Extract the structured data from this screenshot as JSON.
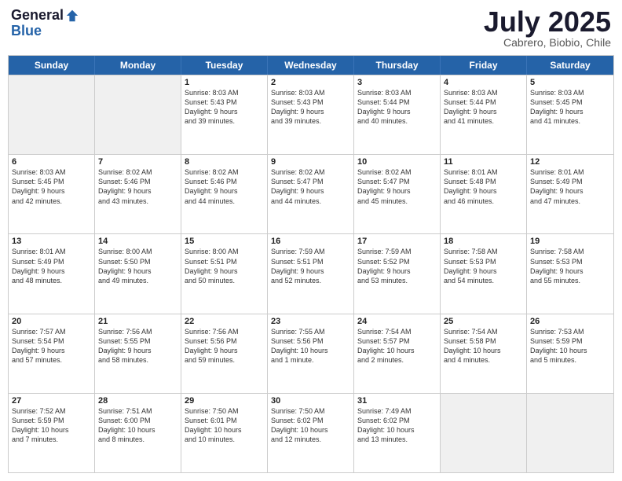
{
  "logo": {
    "general": "General",
    "blue": "Blue"
  },
  "title": "July 2025",
  "subtitle": "Cabrero, Biobio, Chile",
  "weekdays": [
    "Sunday",
    "Monday",
    "Tuesday",
    "Wednesday",
    "Thursday",
    "Friday",
    "Saturday"
  ],
  "weeks": [
    [
      {
        "day": "",
        "text": "",
        "shaded": true
      },
      {
        "day": "",
        "text": "",
        "shaded": true
      },
      {
        "day": "1",
        "text": "Sunrise: 8:03 AM\nSunset: 5:43 PM\nDaylight: 9 hours\nand 39 minutes."
      },
      {
        "day": "2",
        "text": "Sunrise: 8:03 AM\nSunset: 5:43 PM\nDaylight: 9 hours\nand 39 minutes."
      },
      {
        "day": "3",
        "text": "Sunrise: 8:03 AM\nSunset: 5:44 PM\nDaylight: 9 hours\nand 40 minutes."
      },
      {
        "day": "4",
        "text": "Sunrise: 8:03 AM\nSunset: 5:44 PM\nDaylight: 9 hours\nand 41 minutes."
      },
      {
        "day": "5",
        "text": "Sunrise: 8:03 AM\nSunset: 5:45 PM\nDaylight: 9 hours\nand 41 minutes."
      }
    ],
    [
      {
        "day": "6",
        "text": "Sunrise: 8:03 AM\nSunset: 5:45 PM\nDaylight: 9 hours\nand 42 minutes."
      },
      {
        "day": "7",
        "text": "Sunrise: 8:02 AM\nSunset: 5:46 PM\nDaylight: 9 hours\nand 43 minutes."
      },
      {
        "day": "8",
        "text": "Sunrise: 8:02 AM\nSunset: 5:46 PM\nDaylight: 9 hours\nand 44 minutes."
      },
      {
        "day": "9",
        "text": "Sunrise: 8:02 AM\nSunset: 5:47 PM\nDaylight: 9 hours\nand 44 minutes."
      },
      {
        "day": "10",
        "text": "Sunrise: 8:02 AM\nSunset: 5:47 PM\nDaylight: 9 hours\nand 45 minutes."
      },
      {
        "day": "11",
        "text": "Sunrise: 8:01 AM\nSunset: 5:48 PM\nDaylight: 9 hours\nand 46 minutes."
      },
      {
        "day": "12",
        "text": "Sunrise: 8:01 AM\nSunset: 5:49 PM\nDaylight: 9 hours\nand 47 minutes."
      }
    ],
    [
      {
        "day": "13",
        "text": "Sunrise: 8:01 AM\nSunset: 5:49 PM\nDaylight: 9 hours\nand 48 minutes."
      },
      {
        "day": "14",
        "text": "Sunrise: 8:00 AM\nSunset: 5:50 PM\nDaylight: 9 hours\nand 49 minutes."
      },
      {
        "day": "15",
        "text": "Sunrise: 8:00 AM\nSunset: 5:51 PM\nDaylight: 9 hours\nand 50 minutes."
      },
      {
        "day": "16",
        "text": "Sunrise: 7:59 AM\nSunset: 5:51 PM\nDaylight: 9 hours\nand 52 minutes."
      },
      {
        "day": "17",
        "text": "Sunrise: 7:59 AM\nSunset: 5:52 PM\nDaylight: 9 hours\nand 53 minutes."
      },
      {
        "day": "18",
        "text": "Sunrise: 7:58 AM\nSunset: 5:53 PM\nDaylight: 9 hours\nand 54 minutes."
      },
      {
        "day": "19",
        "text": "Sunrise: 7:58 AM\nSunset: 5:53 PM\nDaylight: 9 hours\nand 55 minutes."
      }
    ],
    [
      {
        "day": "20",
        "text": "Sunrise: 7:57 AM\nSunset: 5:54 PM\nDaylight: 9 hours\nand 57 minutes."
      },
      {
        "day": "21",
        "text": "Sunrise: 7:56 AM\nSunset: 5:55 PM\nDaylight: 9 hours\nand 58 minutes."
      },
      {
        "day": "22",
        "text": "Sunrise: 7:56 AM\nSunset: 5:56 PM\nDaylight: 9 hours\nand 59 minutes."
      },
      {
        "day": "23",
        "text": "Sunrise: 7:55 AM\nSunset: 5:56 PM\nDaylight: 10 hours\nand 1 minute."
      },
      {
        "day": "24",
        "text": "Sunrise: 7:54 AM\nSunset: 5:57 PM\nDaylight: 10 hours\nand 2 minutes."
      },
      {
        "day": "25",
        "text": "Sunrise: 7:54 AM\nSunset: 5:58 PM\nDaylight: 10 hours\nand 4 minutes."
      },
      {
        "day": "26",
        "text": "Sunrise: 7:53 AM\nSunset: 5:59 PM\nDaylight: 10 hours\nand 5 minutes."
      }
    ],
    [
      {
        "day": "27",
        "text": "Sunrise: 7:52 AM\nSunset: 5:59 PM\nDaylight: 10 hours\nand 7 minutes."
      },
      {
        "day": "28",
        "text": "Sunrise: 7:51 AM\nSunset: 6:00 PM\nDaylight: 10 hours\nand 8 minutes."
      },
      {
        "day": "29",
        "text": "Sunrise: 7:50 AM\nSunset: 6:01 PM\nDaylight: 10 hours\nand 10 minutes."
      },
      {
        "day": "30",
        "text": "Sunrise: 7:50 AM\nSunset: 6:02 PM\nDaylight: 10 hours\nand 12 minutes."
      },
      {
        "day": "31",
        "text": "Sunrise: 7:49 AM\nSunset: 6:02 PM\nDaylight: 10 hours\nand 13 minutes."
      },
      {
        "day": "",
        "text": "",
        "shaded": true
      },
      {
        "day": "",
        "text": "",
        "shaded": true
      }
    ]
  ]
}
